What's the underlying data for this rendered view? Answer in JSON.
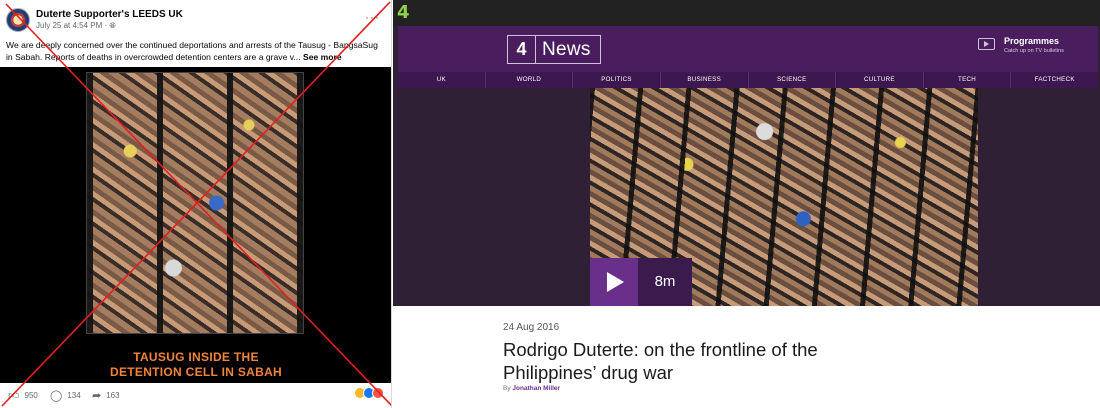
{
  "facebook_post": {
    "page_name": "Duterte Supporter's LEEDS UK",
    "meta": "July 25 at 4:54 PM · ",
    "meta_icon": "globe-icon",
    "caption": "We are deeply concerned over the continued deportations and arrests of the Tausug - BangsaSug in Sabah. Reports of deaths in overcrowded detention centers are a grave v...",
    "see_more": "See more",
    "image_text_line1": "TAUSUG INSIDE THE",
    "image_text_line2": "DETENTION CELL IN SABAH",
    "image_text_color": "#f0843a",
    "likes": "950",
    "comments": "134",
    "shares": "163",
    "overlay_mark_color": "#e02020"
  },
  "channel4": {
    "small_logo": "4",
    "brand_number": "4",
    "brand_word": "News",
    "programmes": {
      "title": "Programmes",
      "subtitle": "Catch up on TV bulletins"
    },
    "nav": [
      "UK",
      "WORLD",
      "POLITICS",
      "BUSINESS",
      "SCIENCE",
      "CULTURE",
      "TECH",
      "FACTCHECK"
    ],
    "video_duration": "8m",
    "date": "24 Aug 2016",
    "headline": "Rodrigo Duterte: on the frontline of the Philippines’ drug war",
    "by_label": "By",
    "author": "Jonathan Miller",
    "accent_color": "#4a1e5e",
    "logo_green": "#8fd14a"
  }
}
